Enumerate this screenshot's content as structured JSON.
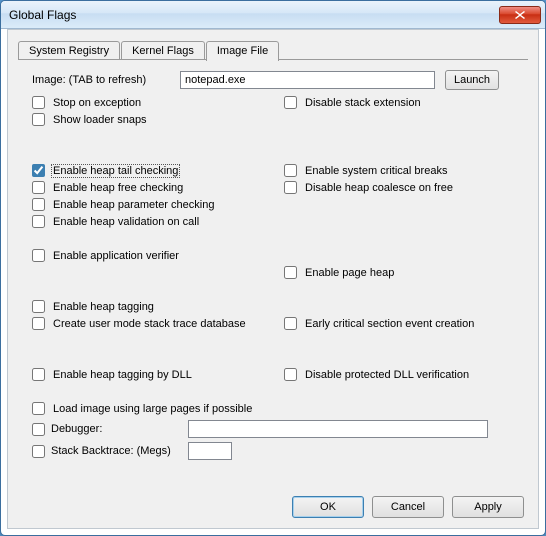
{
  "window": {
    "title": "Global Flags"
  },
  "tabs": [
    {
      "label": "System Registry",
      "active": false
    },
    {
      "label": "Kernel Flags",
      "active": false
    },
    {
      "label": "Image File",
      "active": true
    }
  ],
  "image": {
    "label": "Image: (TAB to refresh)",
    "value": "notepad.exe",
    "launch": "Launch"
  },
  "options": {
    "stop_on_exception": "Stop on exception",
    "show_loader_snaps": "Show loader snaps",
    "disable_stack_extension": "Disable stack extension",
    "enable_heap_tail_checking": "Enable heap tail checking",
    "enable_heap_free_checking": "Enable heap free checking",
    "enable_heap_parameter_checking": "Enable heap parameter checking",
    "enable_heap_validation_on_call": "Enable heap validation on call",
    "enable_system_critical_breaks": "Enable system critical breaks",
    "disable_heap_coalesce_on_free": "Disable heap coalesce on free",
    "enable_application_verifier": "Enable application verifier",
    "enable_page_heap": "Enable page heap",
    "enable_heap_tagging": "Enable heap tagging",
    "create_user_mode_stack_trace_database": "Create user mode stack trace database",
    "early_critical_section_event_creation": "Early critical section event creation",
    "enable_heap_tagging_by_dll": "Enable heap tagging by DLL",
    "disable_protected_dll_verification": "Disable protected DLL verification",
    "load_image_using_large_pages": "Load image using large pages if possible",
    "debugger": "Debugger:",
    "stack_backtrace": "Stack Backtrace: (Megs)"
  },
  "checked": {
    "enable_heap_tail_checking": true
  },
  "fields": {
    "debugger_value": "",
    "stack_backtrace_value": ""
  },
  "buttons": {
    "ok": "OK",
    "cancel": "Cancel",
    "apply": "Apply"
  }
}
